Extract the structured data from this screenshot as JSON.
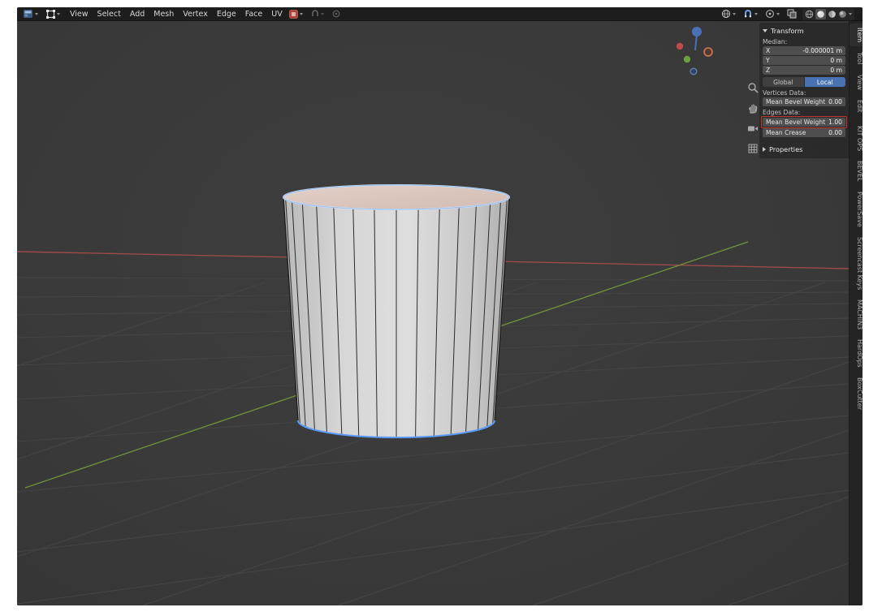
{
  "menubar": {
    "menus": [
      "View",
      "Select",
      "Add",
      "Mesh",
      "Vertex",
      "Edge",
      "Face",
      "UV"
    ]
  },
  "header_icons": {
    "left": [
      "editor-type-icon",
      "mode-selector-icon"
    ],
    "middle": [
      "active-tool-red-icon",
      "snapping-icon",
      "proportional-editing-icon"
    ],
    "right": [
      "transform-orientation-icon",
      "snap-magnet-icon",
      "pivot-point-icon",
      "xray-toggle-icon",
      "shading-wireframe-icon",
      "shading-solid-icon",
      "shading-material-icon",
      "shading-rendered-icon"
    ]
  },
  "viewport": {
    "tools": [
      "zoom-icon",
      "pan-hand-icon",
      "camera-view-icon",
      "orthographic-grid-icon"
    ]
  },
  "sidebar": {
    "tabs": [
      "Item",
      "Tool",
      "View",
      "Edit",
      "KIT OPS",
      "BEVEL",
      "PowerSave",
      "Screencast Keys",
      "MACHIN3",
      "HardOps",
      "BoxCutter"
    ],
    "active_tab": "Item",
    "transform": {
      "title": "Transform",
      "median_label": "Median:",
      "median_rows": [
        {
          "label": "X",
          "value": "-0.000001 m"
        },
        {
          "label": "Y",
          "value": "0 m"
        },
        {
          "label": "Z",
          "value": "0 m"
        }
      ],
      "orientation_buttons": {
        "global": "Global",
        "local": "Local",
        "active": "Local"
      },
      "vertices_section_label": "Vertices Data:",
      "vertices_rows": [
        {
          "label": "Mean Bevel Weight",
          "value": "0.00"
        }
      ],
      "edges_section_label": "Edges Data:",
      "edges_rows": [
        {
          "label": "Mean Bevel Weight",
          "value": "1.00",
          "highlighted": true
        },
        {
          "label": "Mean Crease",
          "value": "0.00"
        }
      ],
      "properties_title": "Properties"
    }
  },
  "colors": {
    "accent_blue": "#4772b3",
    "selection_blue": "#5a9cf8",
    "annotation_red": "#c2342a",
    "axis_x_red": "#9e4a4a",
    "axis_y_green": "#6f8f3a",
    "face_select_pink": "#d8c3ba"
  }
}
